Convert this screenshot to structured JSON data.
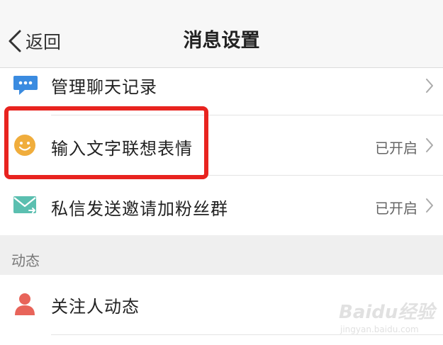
{
  "nav": {
    "back_label": "返回",
    "title": "消息设置"
  },
  "rows": [
    {
      "label": "管理聊天记录",
      "status": "",
      "icon": "chat-bubble-icon"
    },
    {
      "label": "输入文字联想表情",
      "status": "已开启",
      "icon": "smiley-icon"
    },
    {
      "label": "私信发送邀请加粉丝群",
      "status": "已开启",
      "icon": "envelope-share-icon"
    }
  ],
  "section": {
    "title": "动态"
  },
  "rows2": [
    {
      "label": "关注人动态",
      "icon": "person-icon"
    }
  ],
  "watermark": {
    "main": "Baidu经验",
    "sub": "jingyan.baidu.com"
  },
  "colors": {
    "accent_red": "#e8231f",
    "chat_icon": "#3a8be0",
    "smiley_icon": "#f0ad3c",
    "envelope_icon": "#5bbfb0",
    "person_icon": "#e8645a"
  }
}
